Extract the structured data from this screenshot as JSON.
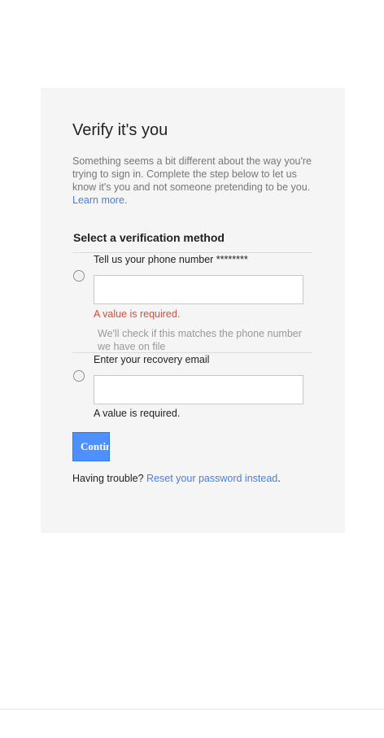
{
  "page": {
    "title": "Verify it's you",
    "intro_text": "Something seems a bit different about the way you're trying to sign in. Complete the step below to let us know it's you and not someone pretending to be you.",
    "learn_more_link": "Learn more",
    "section_heading": "Select a verification method"
  },
  "options": [
    {
      "label": "Tell us your phone number ********",
      "value": "",
      "error": "A value is required.",
      "hint": "We'll check if this matches the phone number we have on file"
    },
    {
      "label": "Enter your recovery email",
      "value": "",
      "error": "A value is required."
    }
  ],
  "actions": {
    "continue_label": "Continue"
  },
  "help": {
    "prefix": "Having trouble?",
    "reset_link": "Reset your password instead"
  },
  "colors": {
    "card_background": "#f5f5f5",
    "link": "#427fed",
    "primary_button": "#4d90fe",
    "error": "#dd4b39",
    "hint": "#999999"
  }
}
